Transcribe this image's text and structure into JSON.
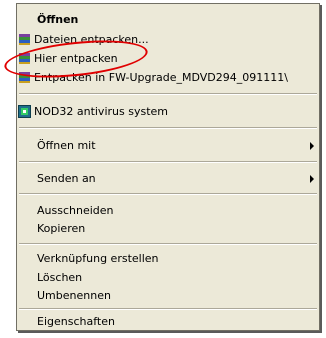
{
  "menu": {
    "items": [
      {
        "label": "Öffnen",
        "bold": true
      },
      {
        "label": "Dateien entpacken...",
        "icon": "winrar-archive-icon"
      },
      {
        "label": "Hier entpacken",
        "icon": "winrar-archive-icon"
      },
      {
        "label": "Entpacken in FW-Upgrade_MDVD294_091111\\",
        "icon": "winrar-archive-icon"
      },
      {
        "label": "NOD32 antivirus system",
        "icon": "nod32-icon"
      },
      {
        "label": "Öffnen mit",
        "submenu": true
      },
      {
        "label": "Senden an",
        "submenu": true
      },
      {
        "label": "Ausschneiden"
      },
      {
        "label": "Kopieren"
      },
      {
        "label": "Verknüpfung erstellen"
      },
      {
        "label": "Löschen"
      },
      {
        "label": "Umbenennen"
      },
      {
        "label": "Eigenschaften"
      }
    ]
  },
  "annotation": {
    "color": "#e00000"
  }
}
